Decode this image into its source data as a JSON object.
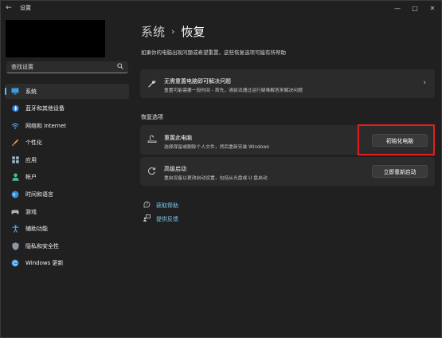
{
  "titlebar": {
    "back": "←",
    "title": "设置",
    "minimize": "—",
    "maximize": "□",
    "close": "✕"
  },
  "search": {
    "placeholder": "查找设置",
    "icon": "search-icon"
  },
  "sidebar": {
    "items": [
      {
        "label": "系统",
        "icon": "monitor-icon",
        "active": true
      },
      {
        "label": "蓝牙和其他设备",
        "icon": "bluetooth-icon"
      },
      {
        "label": "网络和 Internet",
        "icon": "wifi-icon"
      },
      {
        "label": "个性化",
        "icon": "brush-icon"
      },
      {
        "label": "应用",
        "icon": "apps-icon"
      },
      {
        "label": "帐户",
        "icon": "account-icon"
      },
      {
        "label": "时间和语言",
        "icon": "globe-icon"
      },
      {
        "label": "游戏",
        "icon": "gamepad-icon"
      },
      {
        "label": "辅助功能",
        "icon": "accessibility-icon"
      },
      {
        "label": "隐私和安全性",
        "icon": "shield-icon"
      },
      {
        "label": "Windows 更新",
        "icon": "update-icon"
      }
    ]
  },
  "header": {
    "parent": "系统",
    "separator": "›",
    "current": "恢复",
    "subtitle": "如果你的电脑出现问题或希望重置，这些恢复选项可能有所帮助"
  },
  "fix_card": {
    "title": "无需重置电脑即可解决问题",
    "desc": "重置可能需要一段时间 - 首先，请尝试通过运行疑难解答来解决问题",
    "chevron": "›"
  },
  "recovery": {
    "section_label": "恢复选项",
    "reset": {
      "title": "重置此电脑",
      "desc": "选择保留或删除个人文件，然后重新安装 Windows",
      "button": "初始化电脑"
    },
    "advanced": {
      "title": "高级启动",
      "desc": "重启设备以更改启动设置，包括从光盘或 U 盘启动",
      "button": "立即重新启动"
    }
  },
  "links": {
    "help": "获取帮助",
    "feedback": "提供反馈"
  },
  "colors": {
    "background": "#202020",
    "card": "#2b2b2b",
    "accent": "#4cc2ff",
    "link": "#7cc8f0",
    "highlight_box": "#e02020"
  }
}
